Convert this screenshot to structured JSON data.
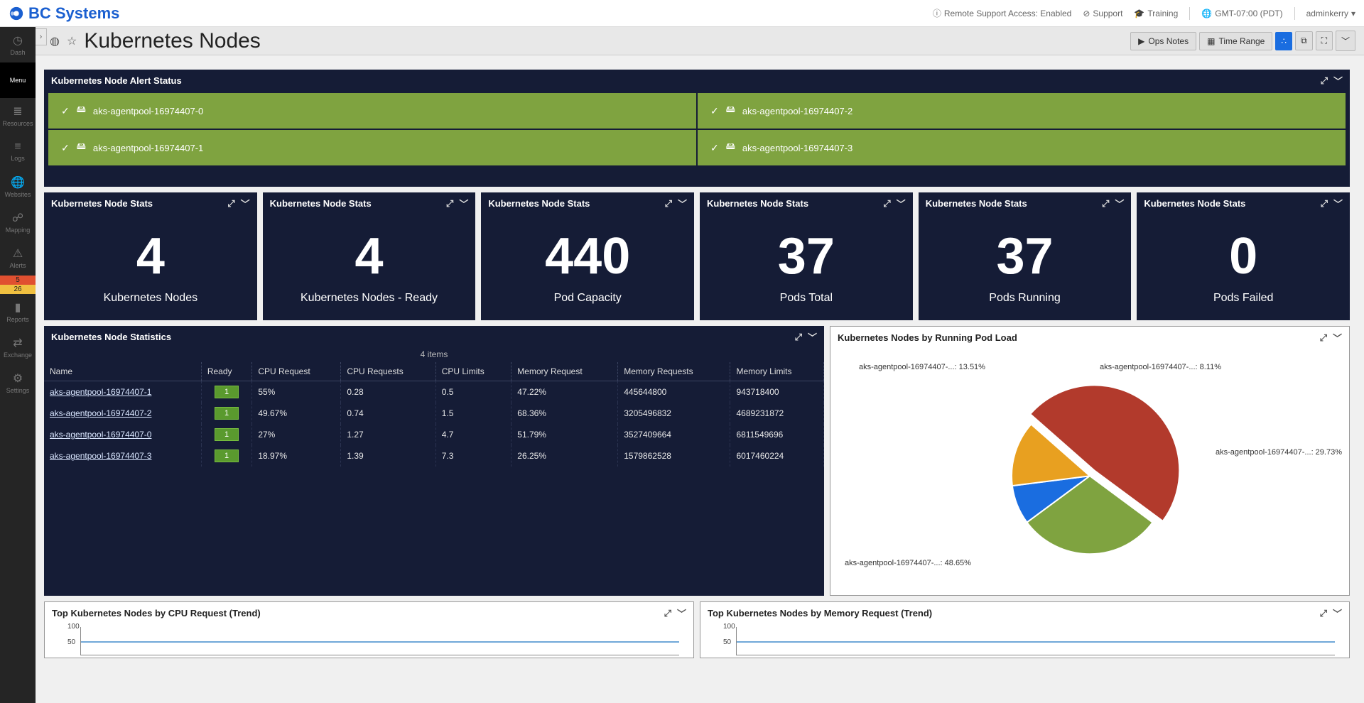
{
  "brand": {
    "name": "BC Systems"
  },
  "topbar": {
    "remote": "Remote Support Access: Enabled",
    "support": "Support",
    "training": "Training",
    "tz": "GMT-07:00 (PDT)",
    "user": "adminkerry"
  },
  "page": {
    "title": "Kubernetes Nodes",
    "ops_notes": "Ops Notes",
    "time_range": "Time Range"
  },
  "sidebar": {
    "items": [
      {
        "label": "Dash"
      },
      {
        "label": "Menu"
      },
      {
        "label": "Resources"
      },
      {
        "label": "Logs"
      },
      {
        "label": "Websites"
      },
      {
        "label": "Mapping"
      },
      {
        "label": "Alerts"
      },
      {
        "label": "Reports"
      },
      {
        "label": "Exchange"
      },
      {
        "label": "Settings"
      }
    ],
    "alert_red": "5",
    "alert_yellow": "26"
  },
  "alert_status": {
    "title": "Kubernetes Node Alert Status",
    "nodes": [
      "aks-agentpool-16974407-0",
      "aks-agentpool-16974407-2",
      "aks-agentpool-16974407-1",
      "aks-agentpool-16974407-3"
    ]
  },
  "stats": {
    "title": "Kubernetes Node Stats",
    "cards": [
      {
        "value": "4",
        "label": "Kubernetes Nodes"
      },
      {
        "value": "4",
        "label": "Kubernetes Nodes - Ready"
      },
      {
        "value": "440",
        "label": "Pod Capacity"
      },
      {
        "value": "37",
        "label": "Pods Total"
      },
      {
        "value": "37",
        "label": "Pods Running"
      },
      {
        "value": "0",
        "label": "Pods Failed"
      }
    ]
  },
  "table": {
    "title": "Kubernetes Node Statistics",
    "item_count": "4 items",
    "headers": [
      "Name",
      "Ready",
      "CPU Request",
      "CPU Requests",
      "CPU Limits",
      "Memory Request",
      "Memory Requests",
      "Memory Limits"
    ],
    "rows": [
      {
        "name": "aks-agentpool-16974407-1",
        "ready": "1",
        "cpu_req": "55%",
        "cpu_reqs": "0.28",
        "cpu_lim": "0.5",
        "mem_req": "47.22%",
        "mem_reqs": "445644800",
        "mem_lim": "943718400"
      },
      {
        "name": "aks-agentpool-16974407-2",
        "ready": "1",
        "cpu_req": "49.67%",
        "cpu_reqs": "0.74",
        "cpu_lim": "1.5",
        "mem_req": "68.36%",
        "mem_reqs": "3205496832",
        "mem_lim": "4689231872"
      },
      {
        "name": "aks-agentpool-16974407-0",
        "ready": "1",
        "cpu_req": "27%",
        "cpu_reqs": "1.27",
        "cpu_lim": "4.7",
        "mem_req": "51.79%",
        "mem_reqs": "3527409664",
        "mem_lim": "6811549696"
      },
      {
        "name": "aks-agentpool-16974407-3",
        "ready": "1",
        "cpu_req": "18.97%",
        "cpu_reqs": "1.39",
        "cpu_lim": "7.3",
        "mem_req": "26.25%",
        "mem_reqs": "1579862528",
        "mem_lim": "6017460224"
      }
    ]
  },
  "pie": {
    "title": "Kubernetes Nodes by Running Pod Load",
    "labels": {
      "a": "aks-agentpool-16974407-...: 13.51%",
      "b": "aks-agentpool-16974407-...: 8.11%",
      "c": "aks-agentpool-16974407-...: 29.73%",
      "d": "aks-agentpool-16974407-...: 48.65%"
    }
  },
  "trends": {
    "cpu_title": "Top Kubernetes Nodes by CPU Request (Trend)",
    "mem_title": "Top Kubernetes Nodes by Memory Request (Trend)",
    "y100": "100",
    "y50": "50"
  },
  "chart_data": {
    "type": "pie",
    "title": "Kubernetes Nodes by Running Pod Load",
    "series": [
      {
        "name": "aks-agentpool-16974407-...",
        "value": 48.65,
        "color": "#b23a2c"
      },
      {
        "name": "aks-agentpool-16974407-...",
        "value": 29.73,
        "color": "#7fa340"
      },
      {
        "name": "aks-agentpool-16974407-...",
        "value": 8.11,
        "color": "#1a6de0"
      },
      {
        "name": "aks-agentpool-16974407-...",
        "value": 13.51,
        "color": "#e8a020"
      }
    ]
  }
}
